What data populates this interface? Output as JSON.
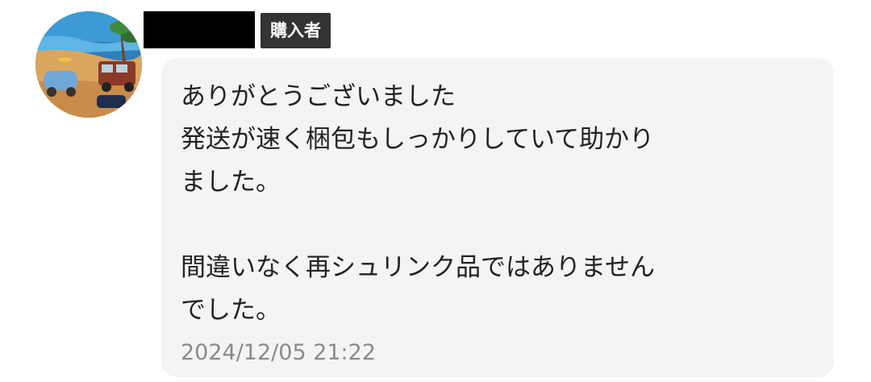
{
  "comment": {
    "role_badge": "購入者",
    "message_lines": [
      "ありがとうございました",
      "発送が速く梱包もしっかりしていて助かり",
      "ました。",
      "",
      "間違いなく再シュリンク品ではありません",
      "でした。"
    ],
    "timestamp": "2024/12/05 21:22"
  }
}
